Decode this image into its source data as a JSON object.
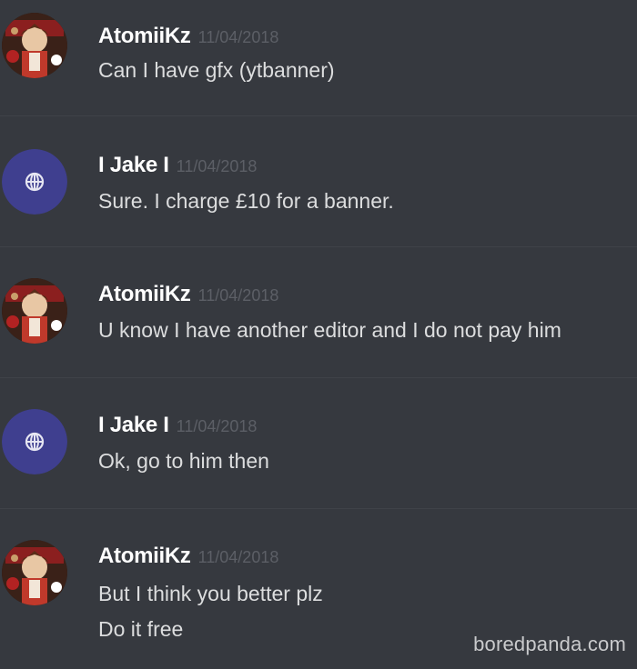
{
  "messages": [
    {
      "author": "AtomiiKz",
      "timestamp": "11/04/2018",
      "avatar_icon": "anime-character-avatar-icon",
      "lines": [
        "Can I have gfx (ytbanner)"
      ]
    },
    {
      "author": "I Jake I",
      "timestamp": "11/04/2018",
      "avatar_icon": "globe-logo-avatar-icon",
      "lines": [
        "Sure. I charge £10 for a banner."
      ]
    },
    {
      "author": "AtomiiKz",
      "timestamp": "11/04/2018",
      "avatar_icon": "anime-character-avatar-icon",
      "lines": [
        "U know I have another editor and I do not pay him"
      ]
    },
    {
      "author": "I Jake I",
      "timestamp": "11/04/2018",
      "avatar_icon": "globe-logo-avatar-icon",
      "lines": [
        "Ok, go to him then"
      ]
    },
    {
      "author": "AtomiiKz",
      "timestamp": "11/04/2018",
      "avatar_icon": "anime-character-avatar-icon",
      "lines": [
        "But I think you better plz",
        "Do it free"
      ]
    }
  ],
  "watermark": "boredpanda.com",
  "colors": {
    "background": "#36393f",
    "username": "#ffffff",
    "timestamp": "#5c5f66",
    "message_text": "#dcddde",
    "jake_avatar_bg": "#3f3f8f"
  }
}
